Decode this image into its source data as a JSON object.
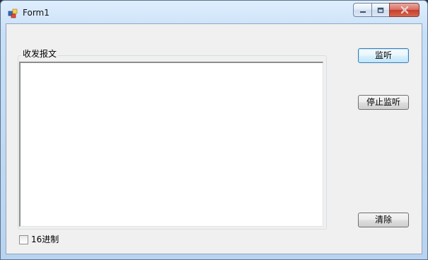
{
  "window": {
    "title": "Form1",
    "icons": {
      "app": "windows-form-icon",
      "minimize": "minimize-icon",
      "maximize": "maximize-icon",
      "close": "close-icon"
    }
  },
  "main": {
    "group_label": "收发报文",
    "message_text": "",
    "checkbox": {
      "label": "16进制",
      "checked": false
    }
  },
  "buttons": {
    "listen": "监听",
    "stop_listen": "停止监听",
    "clear": "清除"
  }
}
